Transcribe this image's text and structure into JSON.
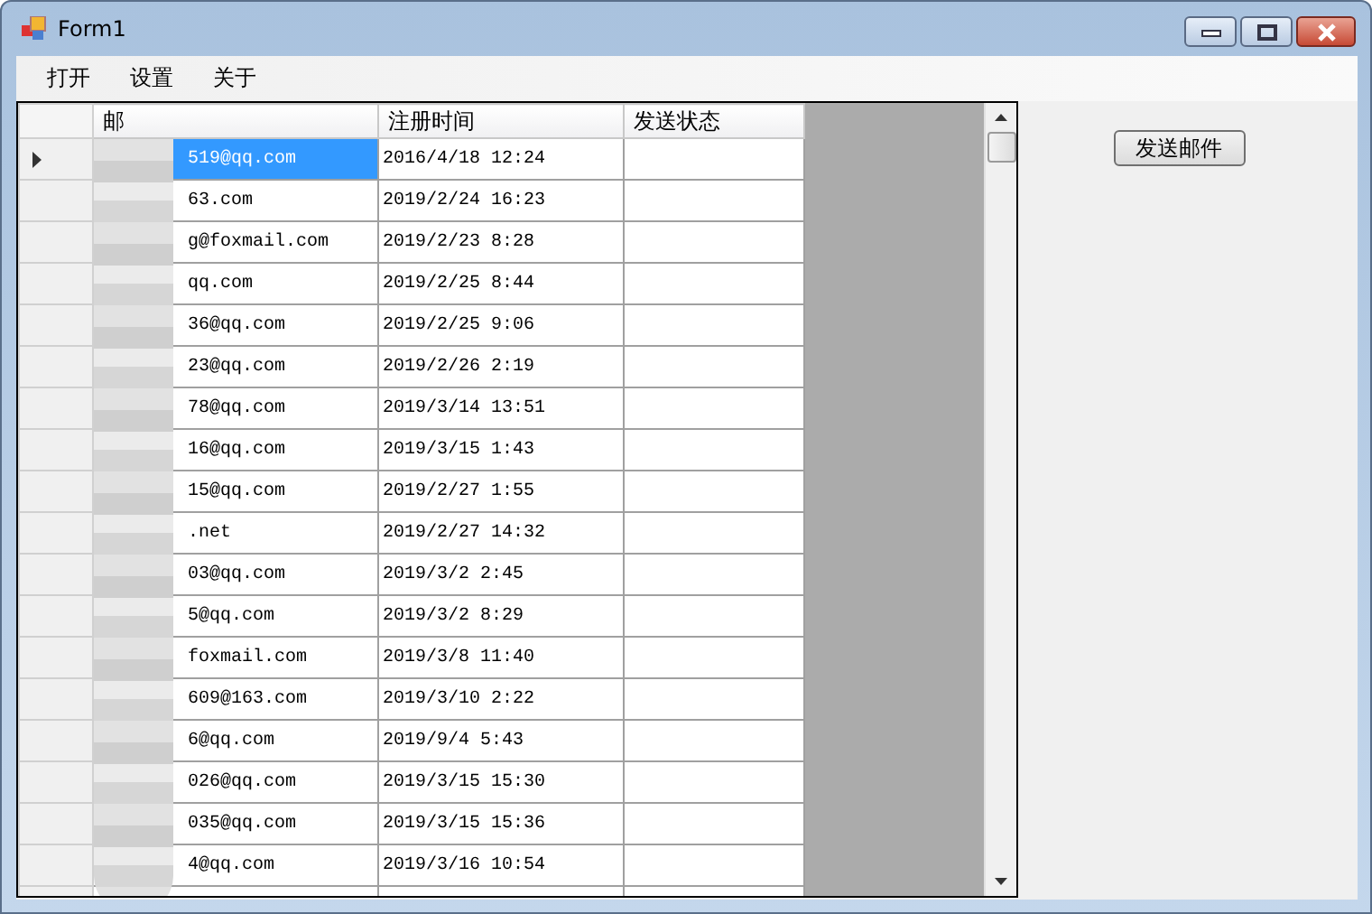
{
  "window": {
    "title": "Form1"
  },
  "menu": [
    {
      "label": "打开"
    },
    {
      "label": "设置"
    },
    {
      "label": "关于"
    }
  ],
  "table": {
    "columns": [
      "邮",
      "注册时间",
      "发送状态"
    ],
    "rows": [
      {
        "email": "519@qq.com",
        "time": "2016/4/18 12:24",
        "selected": true
      },
      {
        "email": "63.com",
        "time": "2019/2/24 16:23",
        "selected": false
      },
      {
        "email": "g@foxmail.com",
        "time": "2019/2/23 8:28",
        "selected": false
      },
      {
        "email": "qq.com",
        "time": "2019/2/25 8:44",
        "selected": false
      },
      {
        "email": "36@qq.com",
        "time": "2019/2/25 9:06",
        "selected": false
      },
      {
        "email": "23@qq.com",
        "time": "2019/2/26 2:19",
        "selected": false
      },
      {
        "email": "78@qq.com",
        "time": "2019/3/14 13:51",
        "selected": false
      },
      {
        "email": "16@qq.com",
        "time": "2019/3/15 1:43",
        "selected": false
      },
      {
        "email": "15@qq.com",
        "time": "2019/2/27 1:55",
        "selected": false
      },
      {
        "email": ".net",
        "time": "2019/2/27 14:32",
        "selected": false
      },
      {
        "email": "03@qq.com",
        "time": "2019/3/2 2:45",
        "selected": false
      },
      {
        "email": "5@qq.com",
        "time": "2019/3/2 8:29",
        "selected": false
      },
      {
        "email": "foxmail.com",
        "time": "2019/3/8 11:40",
        "selected": false
      },
      {
        "email": "609@163.com",
        "time": "2019/3/10 2:22",
        "selected": false
      },
      {
        "email": "6@qq.com",
        "time": "2019/9/4 5:43",
        "selected": false
      },
      {
        "email": "026@qq.com",
        "time": "2019/3/15 15:30",
        "selected": false
      },
      {
        "email": "035@qq.com",
        "time": "2019/3/15 15:36",
        "selected": false
      },
      {
        "email": "4@qq.com",
        "time": "2019/3/16 10:54",
        "selected": false
      }
    ]
  },
  "send_button": {
    "label": "发送邮件"
  }
}
